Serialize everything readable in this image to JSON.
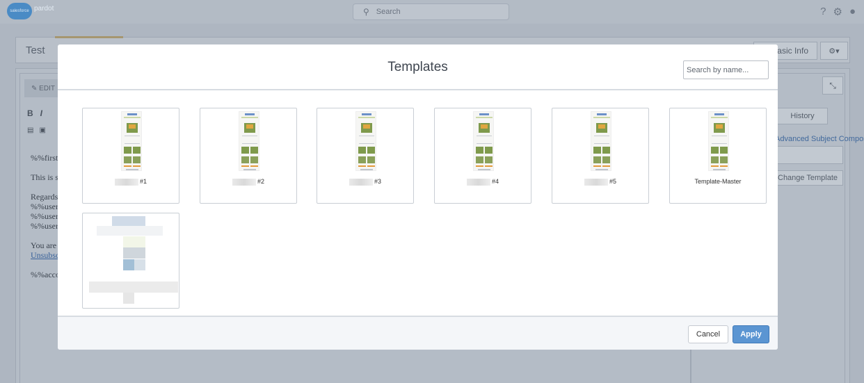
{
  "topbar": {
    "logo_cloud": "salesforce",
    "logo_text": "pardot",
    "search_placeholder": "Search",
    "icons": [
      "help-icon",
      "gear-icon",
      "user-icon"
    ]
  },
  "page": {
    "title": "Test",
    "basic_info_label": "Basic Info",
    "gear_menu_label": "⚙▾"
  },
  "editor": {
    "edit_tab_label": "EDIT",
    "format_buttons": [
      "B",
      "I"
    ],
    "body_lines": [
      "%%first",
      "This is s",
      "Regards",
      "%%user",
      "%%user",
      "%%user",
      "You are",
      "Unsubsc",
      "%%acco"
    ]
  },
  "right_panel": {
    "history_label": "History",
    "subject_composer_link": "Advanced Subject Composer",
    "template_button_label": "Change Template"
  },
  "modal": {
    "title": "Templates",
    "search_placeholder": "Search by name...",
    "templates": [
      {
        "label": "#1"
      },
      {
        "label": "#2"
      },
      {
        "label": "#3"
      },
      {
        "label": "#4"
      },
      {
        "label": "#5"
      },
      {
        "label": "Template-Master"
      }
    ],
    "cancel_label": "Cancel",
    "apply_label": "Apply"
  },
  "colors": {
    "overlay": "#aeb6c1",
    "apply_button": "#5b95d2",
    "footer_bg": "#f4f6f9"
  }
}
